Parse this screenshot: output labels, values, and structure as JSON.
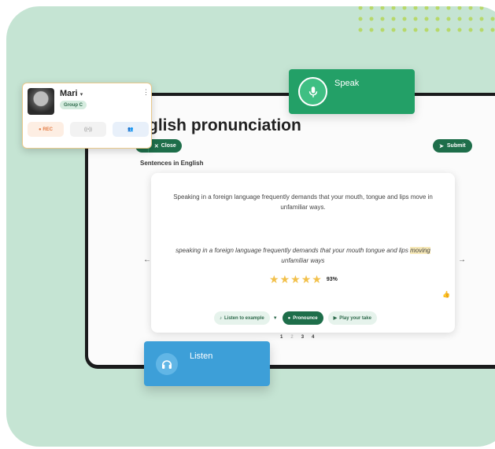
{
  "page": {
    "title": "glish pronunciation",
    "close_label": "Close",
    "submit_label": "Submit",
    "section_label": "Sentences in English"
  },
  "exercise": {
    "sentence_en": "Speaking in a foreign language frequently demands that your mouth, tongue and lips move in unfamiliar ways.",
    "user_take_before": "speaking in a foreign language frequently demands that your mouth tongue and lips ",
    "user_take_highlight": "moving",
    "user_take_after": " unfamiliar ways",
    "stars": 5,
    "score": "93%",
    "actions": {
      "listen": "Listen to example",
      "pronounce": "Pronounce",
      "play": "Play your take"
    },
    "pages": [
      "1",
      "2",
      "3",
      "4"
    ]
  },
  "profile": {
    "name": "Mari",
    "group": "Group C",
    "rec_label": "REC"
  },
  "speak_label": "Speak",
  "listen_label": "Listen",
  "colors": {
    "background": "#c5e4d3",
    "primary_green": "#1e6e4a",
    "speak_green": "#23a067",
    "listen_blue": "#3d9fd8",
    "star": "#f2c04a",
    "rec_orange": "#e47c45"
  }
}
